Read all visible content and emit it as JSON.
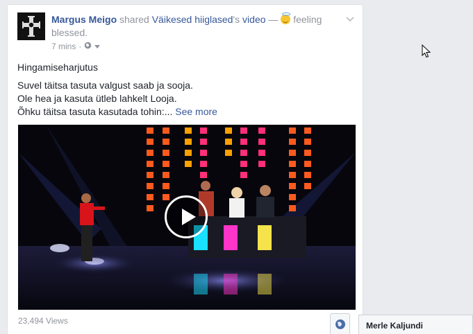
{
  "post": {
    "author": "Margus Meigo",
    "action": "shared",
    "video_owner": "Väikesed hiiglased",
    "possessive": "'s",
    "video_word": "video",
    "dash": "—",
    "feeling": "feeling",
    "feeling_value": "blessed.",
    "timestamp": "7 mins",
    "separator": "·",
    "title": "Hingamiseharjutus",
    "lines": [
      "Suvel täitsa tasuta valgust saab ja sooja.",
      "Ole hea ja kasuta ütleb lahkelt Looja.",
      "Õhku täitsa tasuta kasutada tohin:..."
    ],
    "see_more": "See more",
    "views": "23,494 Views"
  },
  "chat": {
    "contact_name": "Merle Kaljundi"
  },
  "icons": {
    "emoji": "halo-smile-emoji-icon",
    "privacy": "public-globe-icon",
    "menu": "chevron-down-icon",
    "play": "play-icon",
    "globe": "globe-icon",
    "cursor": "mouse-pointer-icon"
  },
  "colors": {
    "link": "#365899",
    "muted": "#90949c",
    "page_bg": "#e9ebee"
  }
}
